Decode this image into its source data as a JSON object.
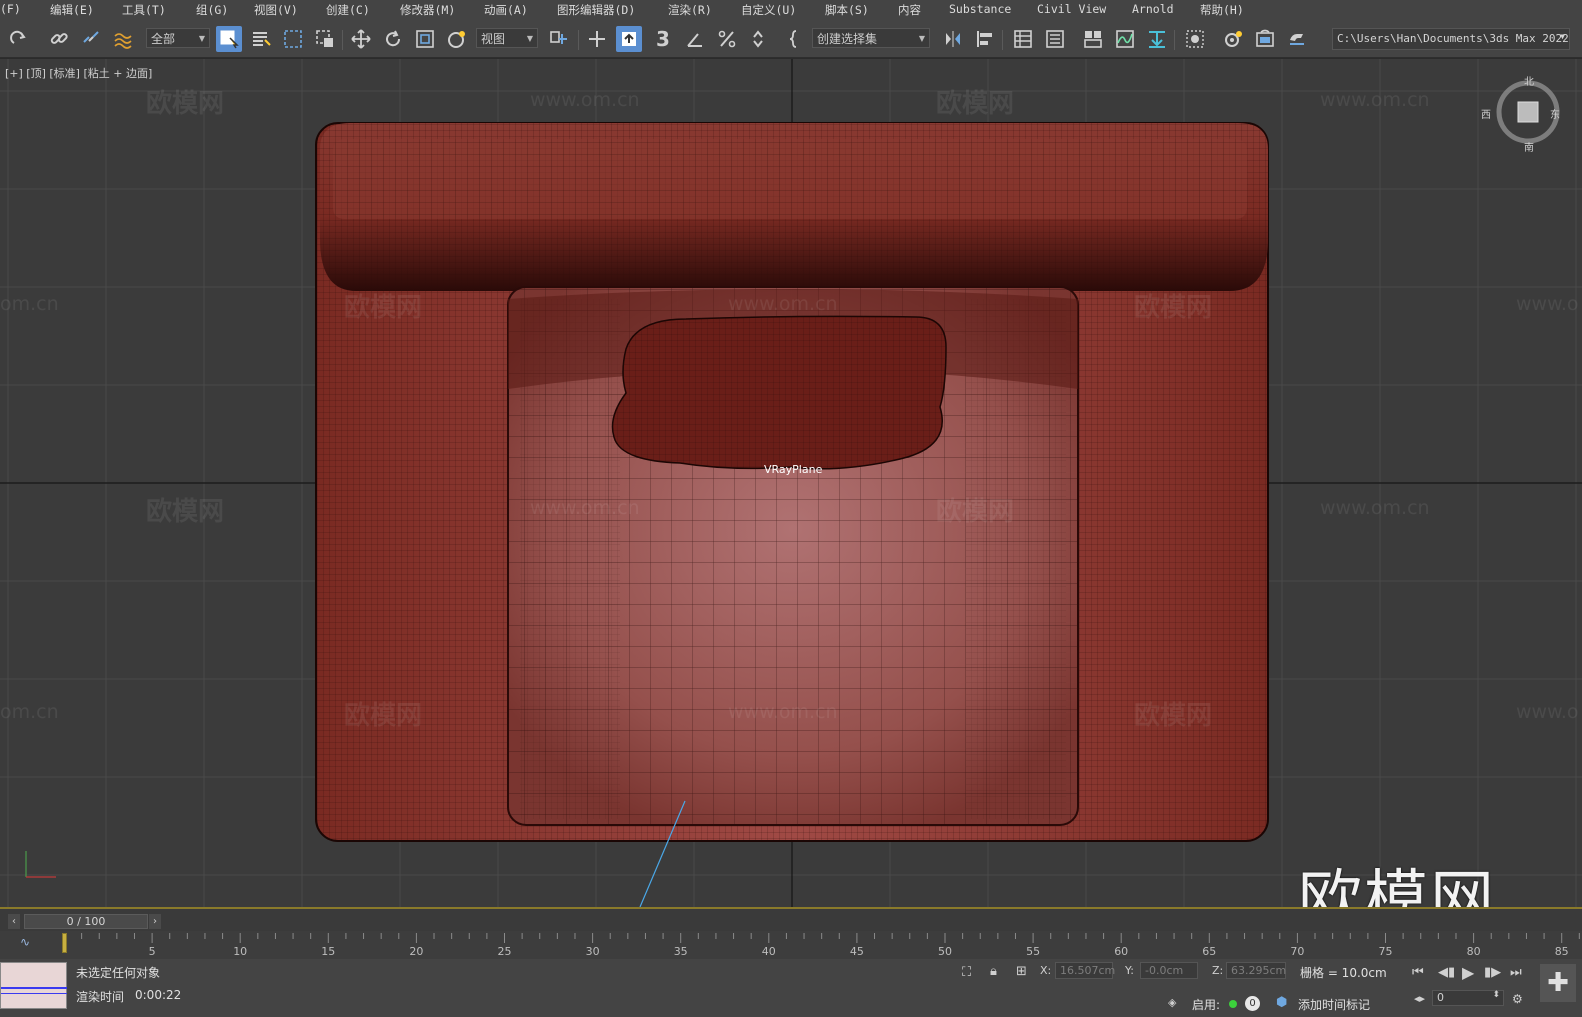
{
  "menu": [
    "(F)",
    "编辑(E)",
    "工具(T)",
    "组(G)",
    "视图(V)",
    "创建(C)",
    "修改器(M)",
    "动画(A)",
    "图形编辑器(D)",
    "渲染(R)",
    "自定义(U)",
    "脚本(S)",
    "内容",
    "Substance",
    "Civil View",
    "Arnold",
    "帮助(H)"
  ],
  "toolbar": {
    "selection_filter": "全部",
    "reference_coord": "视图",
    "named_selection": "创建选择集",
    "snap_label": "3",
    "project_path": "C:\\Users\\Han\\Documents\\3ds Max 2022"
  },
  "viewport": {
    "label": "[+] [顶] [标准] [粘土 + 边面]",
    "object_label": "VRayPlane",
    "watermark_text": "欧模网",
    "watermark_url": "www.om.cn",
    "watermark_partial": "om.cn",
    "watermark_url_partial": "www.o",
    "big_logo": "欧模网",
    "viewcube": {
      "north": "北",
      "south": "南",
      "east": "东",
      "west": "西"
    },
    "colors": {
      "background": "#3b3b3b",
      "model": "#8a3a32",
      "grid": "#4a4a4a"
    }
  },
  "timeline": {
    "frame_display": "0 / 100",
    "ticks": [
      5,
      10,
      15,
      20,
      25,
      30,
      35,
      40,
      45,
      50,
      55,
      60,
      65,
      70,
      75,
      80,
      85
    ]
  },
  "status": {
    "selection": "未选定任何对象",
    "render_time_label": "渲染时间",
    "render_time": "0:00:22",
    "x_label": "X:",
    "x_value": "16.507cm",
    "y_label": "Y:",
    "y_value": "-0.0cm",
    "z_label": "Z:",
    "z_value": "63.295cm",
    "grid": "栅格 = 10.0cm",
    "enable_label": "启用:",
    "enable_count": "0",
    "add_time_tag": "添加时间标记",
    "frame_value": "0"
  }
}
